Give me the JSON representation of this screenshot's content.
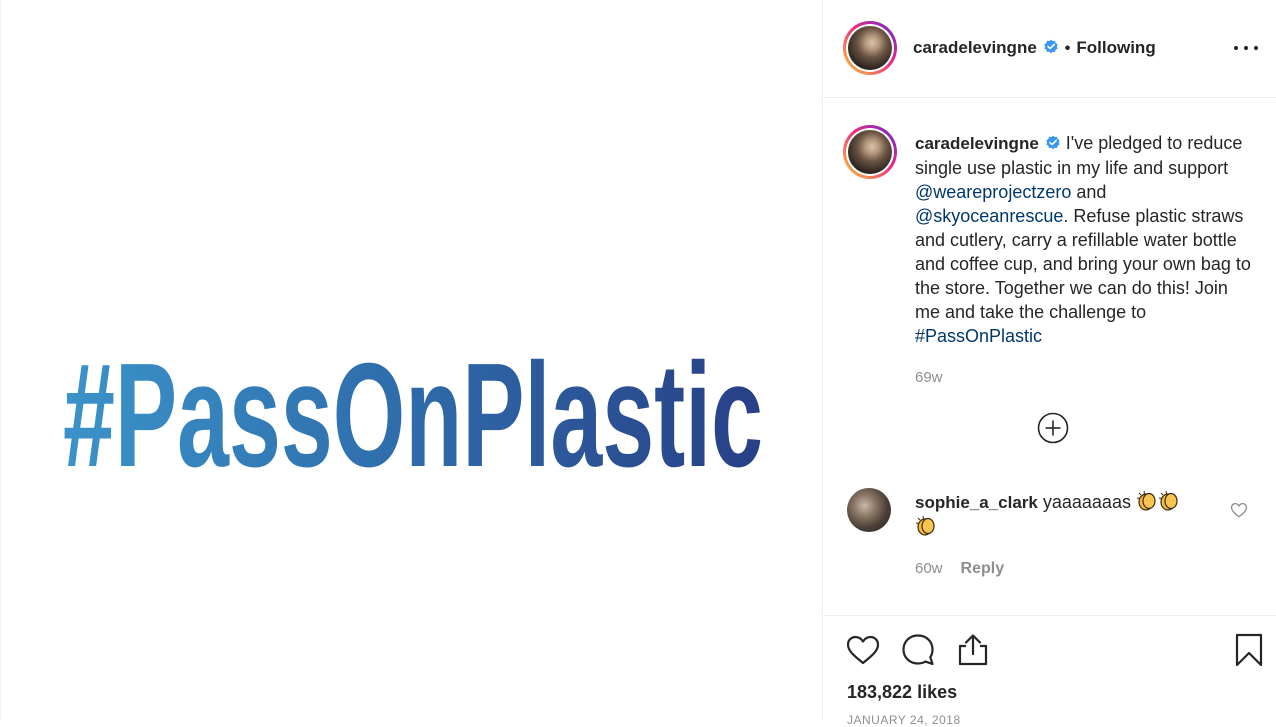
{
  "post": {
    "image_text": "#PassOnPlastic"
  },
  "header": {
    "username": "caradelevingne",
    "separator": "•",
    "follow_status": "Following",
    "more_icon": "more-horizontal-icon"
  },
  "caption": {
    "username": "caradelevingne",
    "text_1": "I've pledged to reduce single use plastic in my life and support",
    "mention_1": "@weareprojectzero",
    "text_2": "and",
    "mention_2": "@skyoceanrescue",
    "text_3": ".  Refuse plastic straws and cutlery, carry a refillable water bottle and coffee cup, and bring your own bag to the store.  Together we can do this!  Join me and take the challenge to",
    "hashtag": "#PassOnPlastic",
    "timestamp": "69w"
  },
  "load_more_icon": "plus-circle-icon",
  "comment": {
    "username": "sophie_a_clark",
    "text": "yaaaaaaas",
    "timestamp": "60w",
    "reply_label": "Reply"
  },
  "actions": {
    "likes": "183,822 likes",
    "date": "JANUARY 24, 2018"
  },
  "colors": {
    "link": "#00376b",
    "muted": "#8e8e8e",
    "verified": "#3897f0",
    "hashtag_gradient_start": "#3a8fc6",
    "hashtag_gradient_end": "#2a3f86"
  }
}
